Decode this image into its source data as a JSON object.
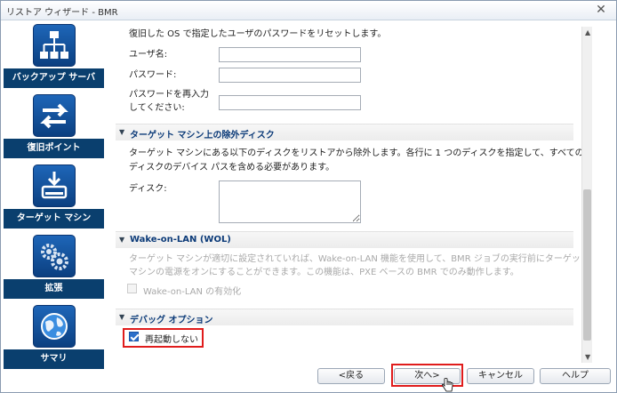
{
  "window": {
    "title": "リストア ウィザード - BMR",
    "close_glyph": "✕"
  },
  "sidebar": {
    "items": [
      {
        "label": "バックアップ サーバ",
        "icon": "network-tree-icon"
      },
      {
        "label": "復旧ポイント",
        "icon": "swap-arrows-icon"
      },
      {
        "label": "ターゲット マシン",
        "icon": "download-drive-icon"
      },
      {
        "label": "拡張",
        "icon": "gears-icon"
      },
      {
        "label": "サマリ",
        "icon": "globe-icon"
      }
    ]
  },
  "reset_password": {
    "description": "復旧した OS で指定したユーザのパスワードをリセットします。",
    "username_label": "ユーザ名:",
    "password_label": "パスワード:",
    "confirm_label_line1": "パスワードを再入力",
    "confirm_label_line2": "してください:",
    "username_value": "",
    "password_value": "",
    "confirm_value": ""
  },
  "exclude_disks": {
    "title": "ターゲット マシン上の除外ディスク",
    "description_line1": "ターゲット マシンにある以下のディスクをリストアから除外します。各行に 1 つのディスクを指定して、すべての",
    "description_line2": "ディスクのデバイス パスを含める必要があります。",
    "disk_label": "ディスク:",
    "disk_value": ""
  },
  "wol": {
    "title": "Wake-on-LAN (WOL)",
    "description_line1": "ターゲット マシンが適切に設定されていれば、Wake-on-LAN 機能を使用して、BMR ジョブの実行前にターゲット",
    "description_line2": "マシンの電源をオンにすることができます。この機能は、PXE ベースの BMR でのみ動作します。",
    "checkbox_label": "Wake-on-LAN の有効化",
    "checked": false
  },
  "debug": {
    "title": "デバッグ オプション",
    "no_reboot_label": "再起動しない",
    "no_reboot_checked": true
  },
  "footer": {
    "back_label": "<戻る",
    "next_label": "次へ>",
    "cancel_label": "キャンセル",
    "help_label": "ヘルプ"
  },
  "colors": {
    "sidebar_label_bg": "#0a3f6e",
    "section_title": "#0b3a78",
    "highlight": "#e01c1c",
    "checkbox_checked": "#2c6fc9"
  }
}
